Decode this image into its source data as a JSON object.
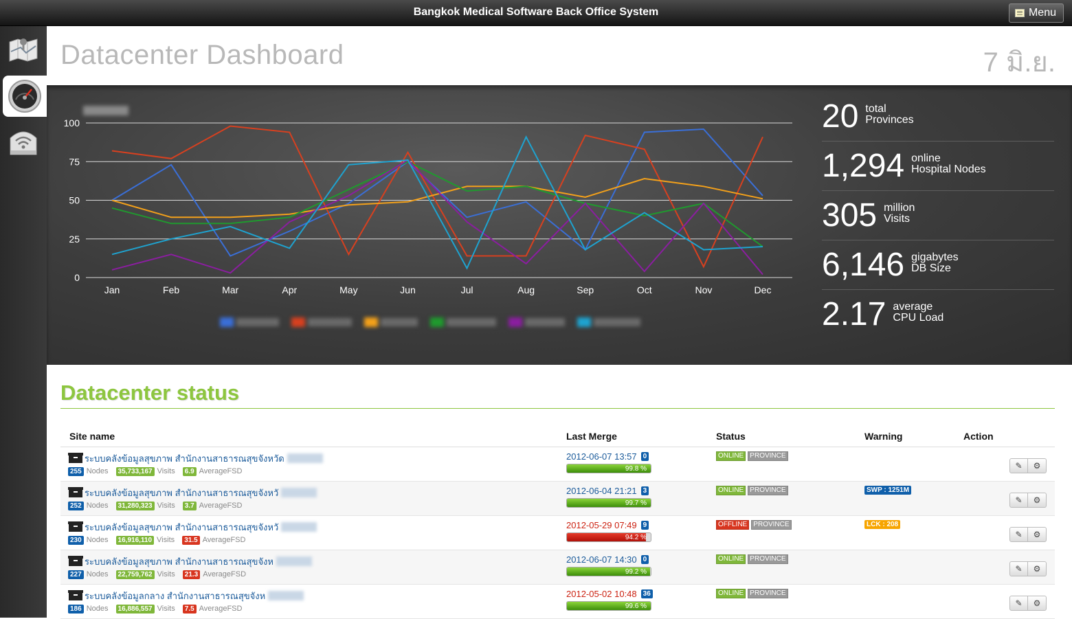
{
  "app": {
    "title": "Bangkok Medical Software Back Office System",
    "menu_label": "Menu"
  },
  "sidebar": {
    "items": [
      {
        "icon": "map-icon"
      },
      {
        "icon": "dashboard-gauge-icon",
        "active": true
      },
      {
        "icon": "wifi-router-icon"
      }
    ]
  },
  "page": {
    "title": "Datacenter Dashboard",
    "date": "7 มิ.ย."
  },
  "chart_data": {
    "type": "line",
    "categories": [
      "Jan",
      "Feb",
      "Mar",
      "Apr",
      "May",
      "Jun",
      "Jul",
      "Aug",
      "Sep",
      "Oct",
      "Nov",
      "Dec"
    ],
    "ylim": [
      0,
      100
    ],
    "yticks": [
      0,
      25,
      50,
      75,
      100
    ],
    "grid": true,
    "legend": "bottom",
    "series": [
      {
        "color": "#3a6fd8",
        "values": [
          50,
          73,
          14,
          30,
          48,
          75,
          39,
          49,
          18,
          94,
          96,
          53
        ]
      },
      {
        "color": "#d8401f",
        "values": [
          82,
          77,
          98,
          94,
          15,
          81,
          14,
          14,
          92,
          83,
          7,
          91
        ]
      },
      {
        "color": "#f4a11a",
        "values": [
          50,
          39,
          39,
          41,
          47,
          49,
          59,
          59,
          52,
          64,
          59,
          51
        ]
      },
      {
        "color": "#1f9a2e",
        "values": [
          45,
          35,
          35,
          39,
          null,
          75,
          56,
          59,
          48,
          40,
          48,
          20
        ]
      },
      {
        "color": "#8b1ea0",
        "values": [
          5,
          15,
          3,
          36,
          53,
          76,
          36,
          9,
          48,
          4,
          48,
          2
        ]
      },
      {
        "color": "#1ea3d0",
        "values": [
          15,
          25,
          33,
          19,
          73,
          76,
          6,
          91,
          18,
          42,
          18,
          20
        ]
      }
    ]
  },
  "stats": [
    {
      "value": "20",
      "line1": "total",
      "line2": "Provinces"
    },
    {
      "value": "1,294",
      "line1": "online",
      "line2": "Hospital Nodes"
    },
    {
      "value": "305",
      "line1": "million",
      "line2": "Visits"
    },
    {
      "value": "6,146",
      "line1": "gigabytes",
      "line2": "DB Size"
    },
    {
      "value": "2.17",
      "line1": "average",
      "line2": "CPU Load"
    }
  ],
  "status": {
    "title": "Datacenter status",
    "columns": {
      "site": "Site name",
      "merge": "Last Merge",
      "status": "Status",
      "warning": "Warning",
      "action": "Action"
    },
    "labels": {
      "nodes": "Nodes",
      "visits": "Visits",
      "fsd": "AverageFSD"
    },
    "rows": [
      {
        "name": "ระบบคลังข้อมูลสุขภาพ สำนักงานสาธารณสุขจังหวัด",
        "nodes": "255",
        "visits": "35,733,167",
        "fsd": "6.9",
        "fsd_bad": false,
        "date": "2012-06-07 13:57",
        "date_late": false,
        "count": "0",
        "pct": 99.8,
        "pct_text": "99.8 %",
        "state": "ONLINE",
        "type": "PROVINCE",
        "warning": ""
      },
      {
        "name": "ระบบคลังข้อมูลสุขภาพ สำนักงานสาธารณสุขจังหวั",
        "nodes": "252",
        "visits": "31,280,323",
        "fsd": "3.7",
        "fsd_bad": false,
        "date": "2012-06-04 21:21",
        "date_late": false,
        "count": "3",
        "pct": 99.7,
        "pct_text": "99.7 %",
        "state": "ONLINE",
        "type": "PROVINCE",
        "warning": "SWP : 1251M",
        "warning_color": "blue"
      },
      {
        "name": "ระบบคลังข้อมูลสุขภาพ สำนักงานสาธารณสุขจังหวั",
        "nodes": "230",
        "visits": "16,916,110",
        "fsd": "31.5",
        "fsd_bad": true,
        "date": "2012-05-29 07:49",
        "date_late": true,
        "count": "9",
        "pct": 94.2,
        "pct_text": "94.2 %",
        "pct_bad": true,
        "state": "OFFLINE",
        "type": "PROVINCE",
        "warning": "LCK : 208",
        "warning_color": "orange"
      },
      {
        "name": "ระบบคลังข้อมูลสุขภาพ สำนักงานสาธารณสุขจังห",
        "nodes": "227",
        "visits": "22,759,762",
        "fsd": "21.3",
        "fsd_bad": true,
        "date": "2012-06-07 14:30",
        "date_late": false,
        "count": "0",
        "pct": 99.2,
        "pct_text": "99.2 %",
        "state": "ONLINE",
        "type": "PROVINCE",
        "warning": ""
      },
      {
        "name": "ระบบคลังข้อมูลกลาง สำนักงานสาธารณสุขจังห",
        "nodes": "186",
        "visits": "16,886,557",
        "fsd": "7.5",
        "fsd_bad": true,
        "date": "2012-05-02 10:48",
        "date_late": true,
        "count": "36",
        "pct": 99.6,
        "pct_text": "99.6 %",
        "state": "ONLINE",
        "type": "PROVINCE",
        "warning": ""
      }
    ]
  }
}
